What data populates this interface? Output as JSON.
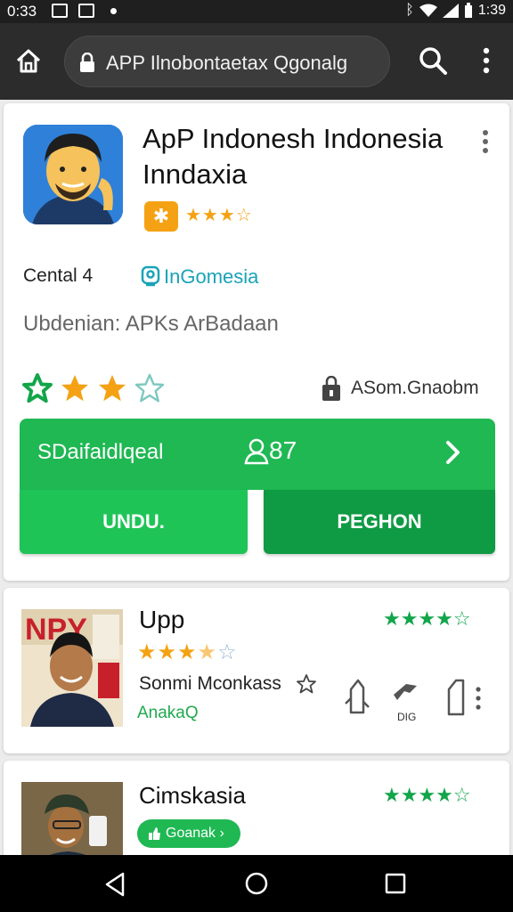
{
  "status_bar": {
    "time_left": "0:33",
    "time_right": "1:39",
    "icons": [
      "mail-icon",
      "image-icon",
      "dot-icon",
      "bluetooth-icon",
      "wifi-icon",
      "signal-icon",
      "battery-icon"
    ]
  },
  "browser": {
    "url": "APP Ilnobontaetax Qgonalg",
    "icons": [
      "home-icon",
      "lock-icon",
      "search-icon",
      "more-vert-icon"
    ]
  },
  "app_card": {
    "title": "ApP Indonesh Indonesia Inndaxia",
    "badge_glyph": "✱",
    "small_stars": "★★★☆",
    "meta_left": "Cental 4",
    "location": "InGomesia",
    "subline": "Ubdenian: APKs ArBadaan",
    "rating": {
      "filled": 2,
      "outline_green": 1,
      "empty": 1
    },
    "size_text": "ASom.Gnaobm",
    "bar_label": "SDaifaidlqeal",
    "user_count": "87",
    "btn_primary": "UNDU.",
    "btn_secondary": "PEGHON",
    "colors": {
      "green": "#1fb853",
      "green_dark": "#0f9a44",
      "orange": "#f4a214",
      "teal": "#1aa3b7"
    }
  },
  "card2": {
    "thumb_text": "NPY",
    "title": "Upp",
    "stars": "★★★",
    "stars_half": "★",
    "stars_empty": "☆",
    "subtitle": "Sonmi Mconkass",
    "tag": "AnakaQ",
    "green_stars": "★★★★☆",
    "action_label": "DIG"
  },
  "card3": {
    "title": "Cimskasia",
    "pill_text": "Goanak ›",
    "green_stars": "★★★★☆"
  }
}
